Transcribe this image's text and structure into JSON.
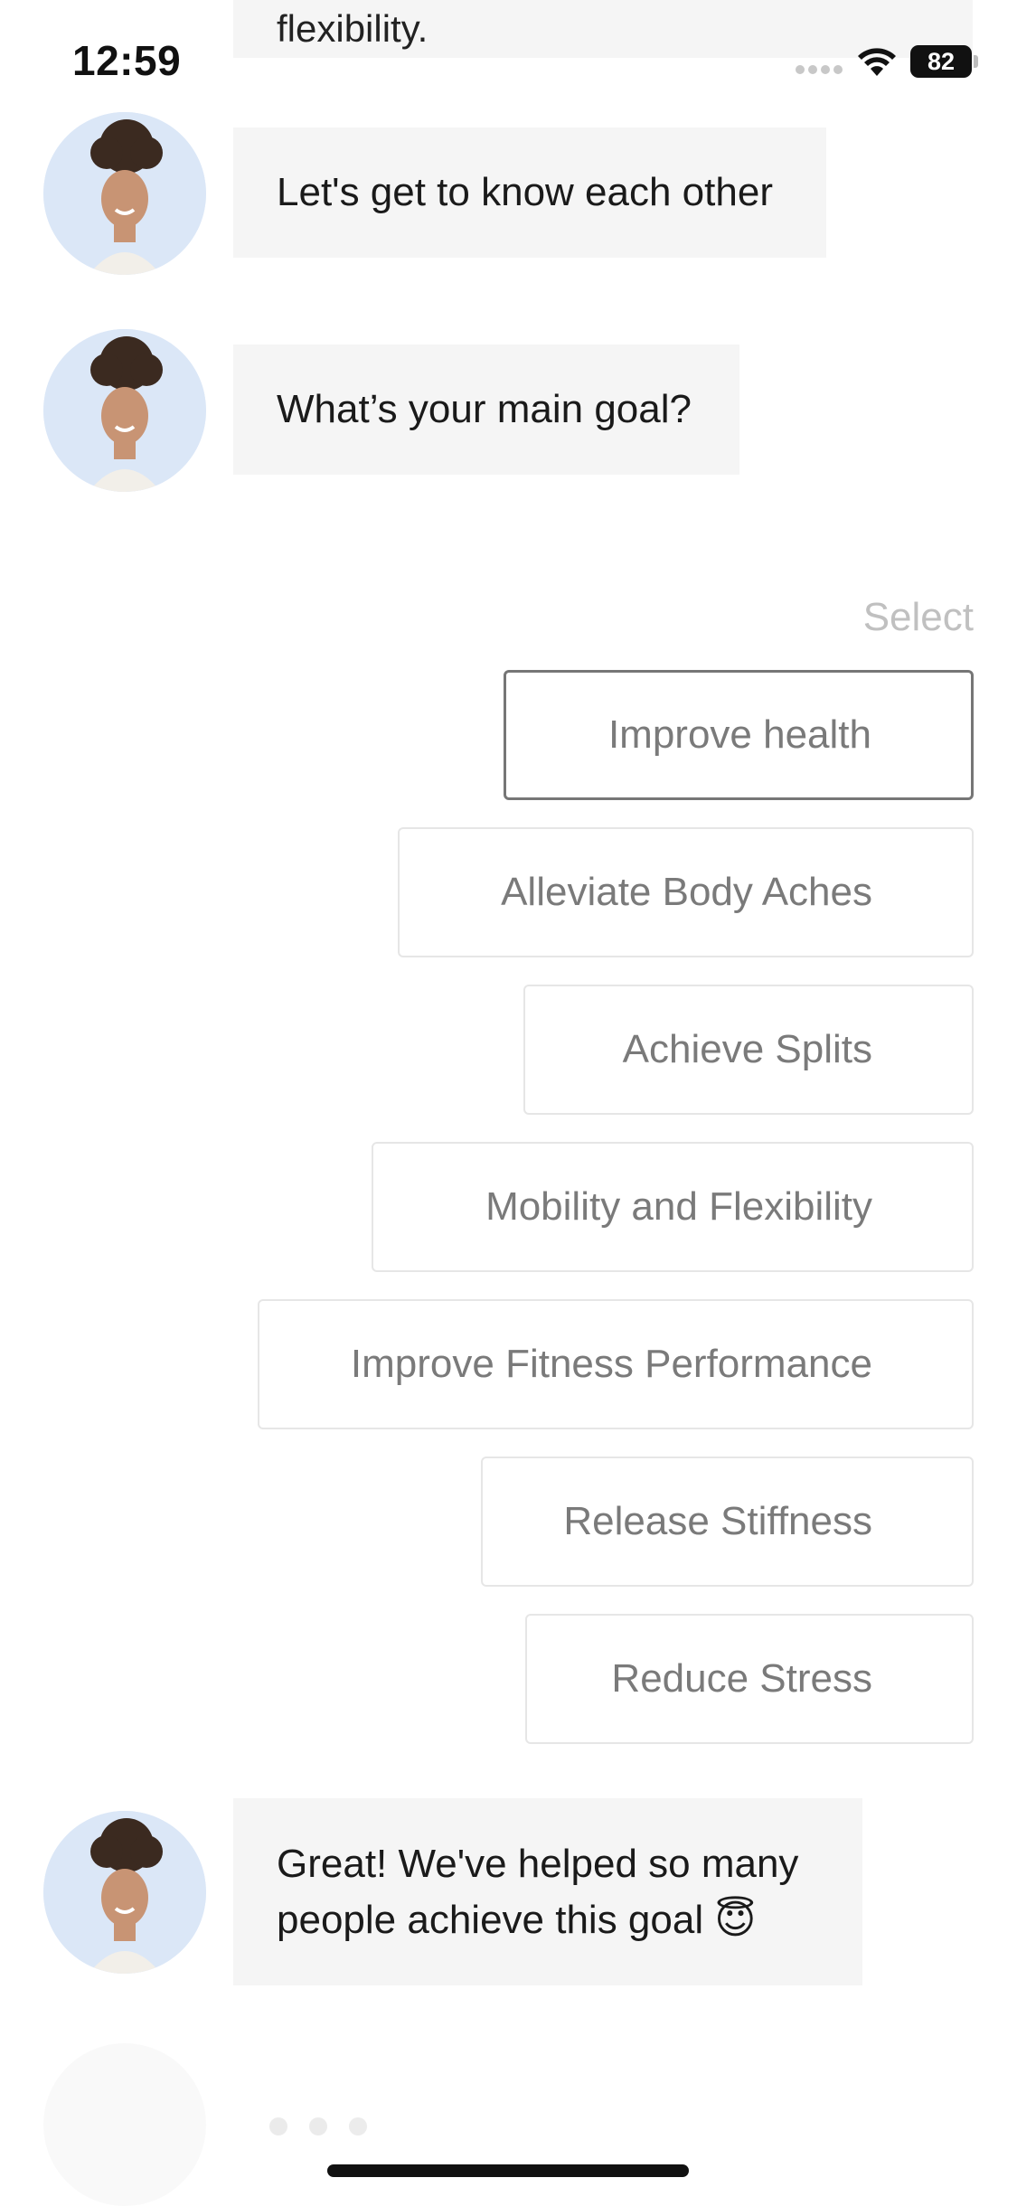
{
  "status_bar": {
    "time": "12:59",
    "battery": "82"
  },
  "chat": {
    "partial_text": "flexibility.",
    "messages": [
      {
        "text": "Let's get to know each other"
      },
      {
        "text": "What’s your main goal?"
      }
    ],
    "select_label": "Select",
    "options": [
      {
        "label": "Improve health",
        "selected": true
      },
      {
        "label": "Alleviate Body Aches",
        "selected": false
      },
      {
        "label": "Achieve Splits",
        "selected": false
      },
      {
        "label": "Mobility and Flexibility",
        "selected": false
      },
      {
        "label": "Improve Fitness Performance",
        "selected": false
      },
      {
        "label": "Release Stiffness",
        "selected": false
      },
      {
        "label": "Reduce Stress",
        "selected": false
      }
    ],
    "reply": {
      "line1": "Great! We've helped so many",
      "line2": "people achieve this goal 😇"
    }
  },
  "colors": {
    "bubble_bg": "#f5f5f5",
    "option_border": "#e6e6e6",
    "option_selected_border": "#767676",
    "option_text": "#7a7a7a",
    "avatar_bg": "#dbe7f7"
  },
  "icons": {
    "wifi": "wifi-icon",
    "battery": "battery-icon",
    "avatar": "coach-avatar"
  }
}
